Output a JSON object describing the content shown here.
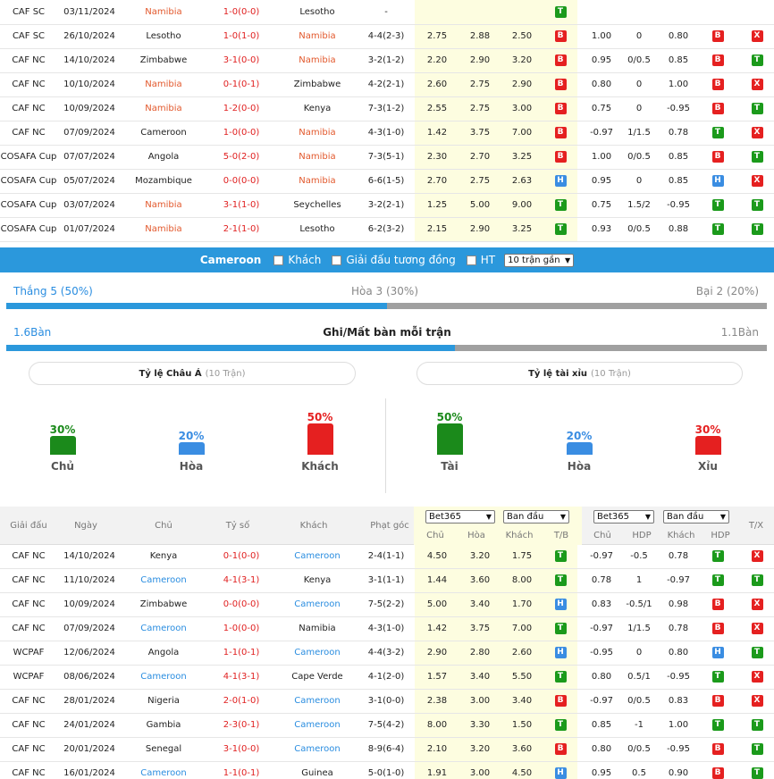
{
  "top_rows": [
    {
      "lg": "CAF SC",
      "date": "03/11/2024",
      "home": "Namibia",
      "hc": "or",
      "score": "1-0(0-0)",
      "away": "Lesotho",
      "ac": "",
      "hcap": "-",
      "c1": "",
      "c2": "",
      "c3": "",
      "r1": "T",
      "a1": "",
      "a2": "",
      "a3": "",
      "r2": "",
      "r3": ""
    },
    {
      "lg": "CAF SC",
      "date": "26/10/2024",
      "home": "Lesotho",
      "hc": "",
      "score": "1-0(1-0)",
      "away": "Namibia",
      "ac": "or",
      "hcap": "4-4(2-3)",
      "c1": "2.75",
      "c2": "2.88",
      "c3": "2.50",
      "r1": "B",
      "a1": "1.00",
      "a2": "0",
      "a3": "0.80",
      "r2": "B",
      "r3": "X"
    },
    {
      "lg": "CAF NC",
      "date": "14/10/2024",
      "home": "Zimbabwe",
      "hc": "",
      "score": "3-1(0-0)",
      "away": "Namibia",
      "ac": "or",
      "hcap": "3-2(1-2)",
      "c1": "2.20",
      "c2": "2.90",
      "c3": "3.20",
      "r1": "B",
      "a1": "0.95",
      "a2": "0/0.5",
      "a3": "0.85",
      "r2": "B",
      "r3": "T"
    },
    {
      "lg": "CAF NC",
      "date": "10/10/2024",
      "home": "Namibia",
      "hc": "or",
      "score": "0-1(0-1)",
      "away": "Zimbabwe",
      "ac": "",
      "hcap": "4-2(2-1)",
      "c1": "2.60",
      "c2": "2.75",
      "c3": "2.90",
      "r1": "B",
      "a1": "0.80",
      "a2": "0",
      "a3": "1.00",
      "r2": "B",
      "r3": "X"
    },
    {
      "lg": "CAF NC",
      "date": "10/09/2024",
      "home": "Namibia",
      "hc": "or",
      "score": "1-2(0-0)",
      "away": "Kenya",
      "ac": "",
      "hcap": "7-3(1-2)",
      "c1": "2.55",
      "c2": "2.75",
      "c3": "3.00",
      "r1": "B",
      "a1": "0.75",
      "a2": "0",
      "a3": "-0.95",
      "r2": "B",
      "r3": "T"
    },
    {
      "lg": "CAF NC",
      "date": "07/09/2024",
      "home": "Cameroon",
      "hc": "",
      "score": "1-0(0-0)",
      "away": "Namibia",
      "ac": "or",
      "hcap": "4-3(1-0)",
      "c1": "1.42",
      "c2": "3.75",
      "c3": "7.00",
      "r1": "B",
      "a1": "-0.97",
      "a2": "1/1.5",
      "a3": "0.78",
      "r2": "T",
      "r3": "X"
    },
    {
      "lg": "COSAFA Cup",
      "date": "07/07/2024",
      "home": "Angola",
      "hc": "",
      "score": "5-0(2-0)",
      "away": "Namibia",
      "ac": "or",
      "hcap": "7-3(5-1)",
      "c1": "2.30",
      "c2": "2.70",
      "c3": "3.25",
      "r1": "B",
      "a1": "1.00",
      "a2": "0/0.5",
      "a3": "0.85",
      "r2": "B",
      "r3": "T"
    },
    {
      "lg": "COSAFA Cup",
      "date": "05/07/2024",
      "home": "Mozambique",
      "hc": "",
      "score": "0-0(0-0)",
      "away": "Namibia",
      "ac": "or",
      "hcap": "6-6(1-5)",
      "c1": "2.70",
      "c2": "2.75",
      "c3": "2.63",
      "r1": "H",
      "a1": "0.95",
      "a2": "0",
      "a3": "0.85",
      "r2": "H",
      "r3": "X"
    },
    {
      "lg": "COSAFA Cup",
      "date": "03/07/2024",
      "home": "Namibia",
      "hc": "or",
      "score": "3-1(1-0)",
      "away": "Seychelles",
      "ac": "",
      "hcap": "3-2(2-1)",
      "c1": "1.25",
      "c2": "5.00",
      "c3": "9.00",
      "r1": "T",
      "a1": "0.75",
      "a2": "1.5/2",
      "a3": "-0.95",
      "r2": "T",
      "r3": "T"
    },
    {
      "lg": "COSAFA Cup",
      "date": "01/07/2024",
      "home": "Namibia",
      "hc": "or",
      "score": "2-1(1-0)",
      "away": "Lesotho",
      "ac": "",
      "hcap": "6-2(3-2)",
      "c1": "2.15",
      "c2": "2.90",
      "c3": "3.25",
      "r1": "T",
      "a1": "0.93",
      "a2": "0/0.5",
      "a3": "0.88",
      "r2": "T",
      "r3": "T"
    }
  ],
  "filter": {
    "team": "Cameroon",
    "opt_away": "Khách",
    "opt_same_league": "Giải đấu tương đồng",
    "opt_ht": "HT",
    "recent": "10 trận gần"
  },
  "stats": {
    "win": "Thắng 5 (50%)",
    "draw": "Hòa 3 (30%)",
    "loss": "Bại 2 (20%)",
    "goals_for": "1.6Bàn",
    "goals_title": "Ghi/Mất bàn mỗi trận",
    "goals_against": "1.1Bàn",
    "win_fraction": 0.5,
    "goals_fraction": 0.59
  },
  "pills": {
    "asia_title": "Tỷ lệ Châu Á",
    "asia_sub": "(10 Trận)",
    "ou_title": "Tỷ lệ tài xỉu",
    "ou_sub": "(10 Trận)"
  },
  "asia_bars": [
    {
      "pct": "30%",
      "label": "Chủ",
      "value": 30,
      "color": "#1b8a1b"
    },
    {
      "pct": "20%",
      "label": "Hòa",
      "value": 20,
      "color": "#3a8de2"
    },
    {
      "pct": "50%",
      "label": "Khách",
      "value": 50,
      "color": "#e52020"
    }
  ],
  "ou_bars": [
    {
      "pct": "50%",
      "label": "Tài",
      "value": 50,
      "color": "#1b8a1b"
    },
    {
      "pct": "20%",
      "label": "Hòa",
      "value": 20,
      "color": "#3a8de2"
    },
    {
      "pct": "30%",
      "label": "Xỉu",
      "value": 30,
      "color": "#e52020"
    }
  ],
  "header": {
    "league": "Giải đấu",
    "date": "Ngày",
    "home": "Chủ",
    "score": "Tỷ số",
    "away": "Khách",
    "corner": "Phạt góc",
    "book1": "Bet365",
    "book2": "Ban đầu",
    "book3": "Bet365",
    "book4": "Ban đầu",
    "tx": "T/X",
    "sub_home": "Chủ",
    "sub_draw": "Hòa",
    "sub_away": "Khách",
    "sub_tb": "T/B",
    "sub_home2": "Chủ",
    "sub_hdp": "HDP",
    "sub_away2": "Khách",
    "sub_hdp2": "HDP"
  },
  "bottom_rows": [
    {
      "lg": "CAF NC",
      "date": "14/10/2024",
      "home": "Kenya",
      "hc": "",
      "score": "0-1(0-0)",
      "away": "Cameroon",
      "ac": "bl",
      "hcap": "2-4(1-1)",
      "c1": "4.50",
      "c2": "3.20",
      "c3": "1.75",
      "r1": "T",
      "a1": "-0.97",
      "a2": "-0.5",
      "a3": "0.78",
      "r2": "T",
      "r3": "X"
    },
    {
      "lg": "CAF NC",
      "date": "11/10/2024",
      "home": "Cameroon",
      "hc": "bl",
      "score": "4-1(3-1)",
      "away": "Kenya",
      "ac": "",
      "hcap": "3-1(1-1)",
      "c1": "1.44",
      "c2": "3.60",
      "c3": "8.00",
      "r1": "T",
      "a1": "0.78",
      "a2": "1",
      "a3": "-0.97",
      "r2": "T",
      "r3": "T"
    },
    {
      "lg": "CAF NC",
      "date": "10/09/2024",
      "home": "Zimbabwe",
      "hc": "",
      "score": "0-0(0-0)",
      "away": "Cameroon",
      "ac": "bl",
      "hcap": "7-5(2-2)",
      "c1": "5.00",
      "c2": "3.40",
      "c3": "1.70",
      "r1": "H",
      "a1": "0.83",
      "a2": "-0.5/1",
      "a3": "0.98",
      "r2": "B",
      "r3": "X"
    },
    {
      "lg": "CAF NC",
      "date": "07/09/2024",
      "home": "Cameroon",
      "hc": "bl",
      "score": "1-0(0-0)",
      "away": "Namibia",
      "ac": "",
      "hcap": "4-3(1-0)",
      "c1": "1.42",
      "c2": "3.75",
      "c3": "7.00",
      "r1": "T",
      "a1": "-0.97",
      "a2": "1/1.5",
      "a3": "0.78",
      "r2": "B",
      "r3": "X"
    },
    {
      "lg": "WCPAF",
      "date": "12/06/2024",
      "home": "Angola",
      "hc": "",
      "score": "1-1(0-1)",
      "away": "Cameroon",
      "ac": "bl",
      "hcap": "4-4(3-2)",
      "c1": "2.90",
      "c2": "2.80",
      "c3": "2.60",
      "r1": "H",
      "a1": "-0.95",
      "a2": "0",
      "a3": "0.80",
      "r2": "H",
      "r3": "T"
    },
    {
      "lg": "WCPAF",
      "date": "08/06/2024",
      "home": "Cameroon",
      "hc": "bl",
      "score": "4-1(3-1)",
      "away": "Cape Verde",
      "ac": "",
      "hcap": "4-1(2-0)",
      "c1": "1.57",
      "c2": "3.40",
      "c3": "5.50",
      "r1": "T",
      "a1": "0.80",
      "a2": "0.5/1",
      "a3": "-0.95",
      "r2": "T",
      "r3": "X"
    },
    {
      "lg": "CAF NC",
      "date": "28/01/2024",
      "home": "Nigeria",
      "hc": "",
      "score": "2-0(1-0)",
      "away": "Cameroon",
      "ac": "bl",
      "hcap": "3-1(0-0)",
      "c1": "2.38",
      "c2": "3.00",
      "c3": "3.40",
      "r1": "B",
      "a1": "-0.97",
      "a2": "0/0.5",
      "a3": "0.83",
      "r2": "B",
      "r3": "X"
    },
    {
      "lg": "CAF NC",
      "date": "24/01/2024",
      "home": "Gambia",
      "hc": "",
      "score": "2-3(0-1)",
      "away": "Cameroon",
      "ac": "bl",
      "hcap": "7-5(4-2)",
      "c1": "8.00",
      "c2": "3.30",
      "c3": "1.50",
      "r1": "T",
      "a1": "0.85",
      "a2": "-1",
      "a3": "1.00",
      "r2": "T",
      "r3": "T"
    },
    {
      "lg": "CAF NC",
      "date": "20/01/2024",
      "home": "Senegal",
      "hc": "",
      "score": "3-1(0-0)",
      "away": "Cameroon",
      "ac": "bl",
      "hcap": "8-9(6-4)",
      "c1": "2.10",
      "c2": "3.20",
      "c3": "3.60",
      "r1": "B",
      "a1": "0.80",
      "a2": "0/0.5",
      "a3": "-0.95",
      "r2": "B",
      "r3": "T"
    },
    {
      "lg": "CAF NC",
      "date": "16/01/2024",
      "home": "Cameroon",
      "hc": "bl",
      "score": "1-1(0-1)",
      "away": "Guinea",
      "ac": "",
      "hcap": "5-0(1-0)",
      "c1": "1.91",
      "c2": "3.00",
      "c3": "4.50",
      "r1": "H",
      "a1": "0.95",
      "a2": "0.5",
      "a3": "0.90",
      "r2": "B",
      "r3": "T"
    }
  ]
}
